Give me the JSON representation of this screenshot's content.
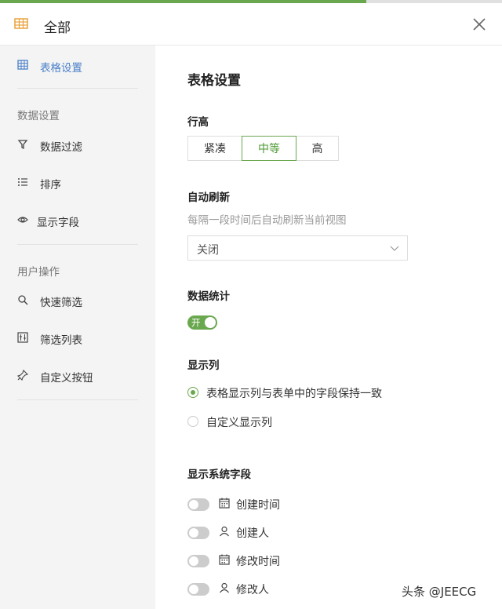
{
  "progress": 0.73,
  "header": {
    "title": "全部",
    "app_icon": "table-icon",
    "close_icon": "close-icon"
  },
  "sidebar": {
    "active_item": {
      "label": "表格设置",
      "icon": "table-grid-icon"
    },
    "groups": [
      {
        "title": "数据设置",
        "items": [
          {
            "label": "数据过滤",
            "icon": "filter-icon"
          },
          {
            "label": "排序",
            "icon": "sort-list-icon"
          },
          {
            "label": "显示字段",
            "icon": "eye-icon"
          }
        ]
      },
      {
        "title": "用户操作",
        "items": [
          {
            "label": "快速筛选",
            "icon": "search-icon"
          },
          {
            "label": "筛选列表",
            "icon": "filter-list-icon"
          },
          {
            "label": "自定义按钮",
            "icon": "pin-icon"
          }
        ]
      }
    ]
  },
  "main": {
    "title": "表格设置",
    "row_height": {
      "label": "行高",
      "options": [
        "紧凑",
        "中等",
        "高"
      ],
      "selected": "中等"
    },
    "auto_refresh": {
      "label": "自动刷新",
      "hint": "每隔一段时间后自动刷新当前视图",
      "value": "关闭"
    },
    "statistics": {
      "label": "数据统计",
      "switch_text": "开",
      "on": true
    },
    "columns": {
      "label": "显示列",
      "options": [
        "表格显示列与表单中的字段保持一致",
        "自定义显示列"
      ],
      "selected": 0
    },
    "system_fields": {
      "label": "显示系统字段",
      "items": [
        {
          "label": "创建时间",
          "icon": "calendar-icon",
          "on": false
        },
        {
          "label": "创建人",
          "icon": "user-icon",
          "on": false
        },
        {
          "label": "修改时间",
          "icon": "calendar-icon",
          "on": false
        },
        {
          "label": "修改人",
          "icon": "user-icon",
          "on": false
        }
      ]
    }
  },
  "watermark": "头条 @JEECG",
  "colors": {
    "accent": "#6aa84f",
    "link": "#4a7fc8"
  }
}
